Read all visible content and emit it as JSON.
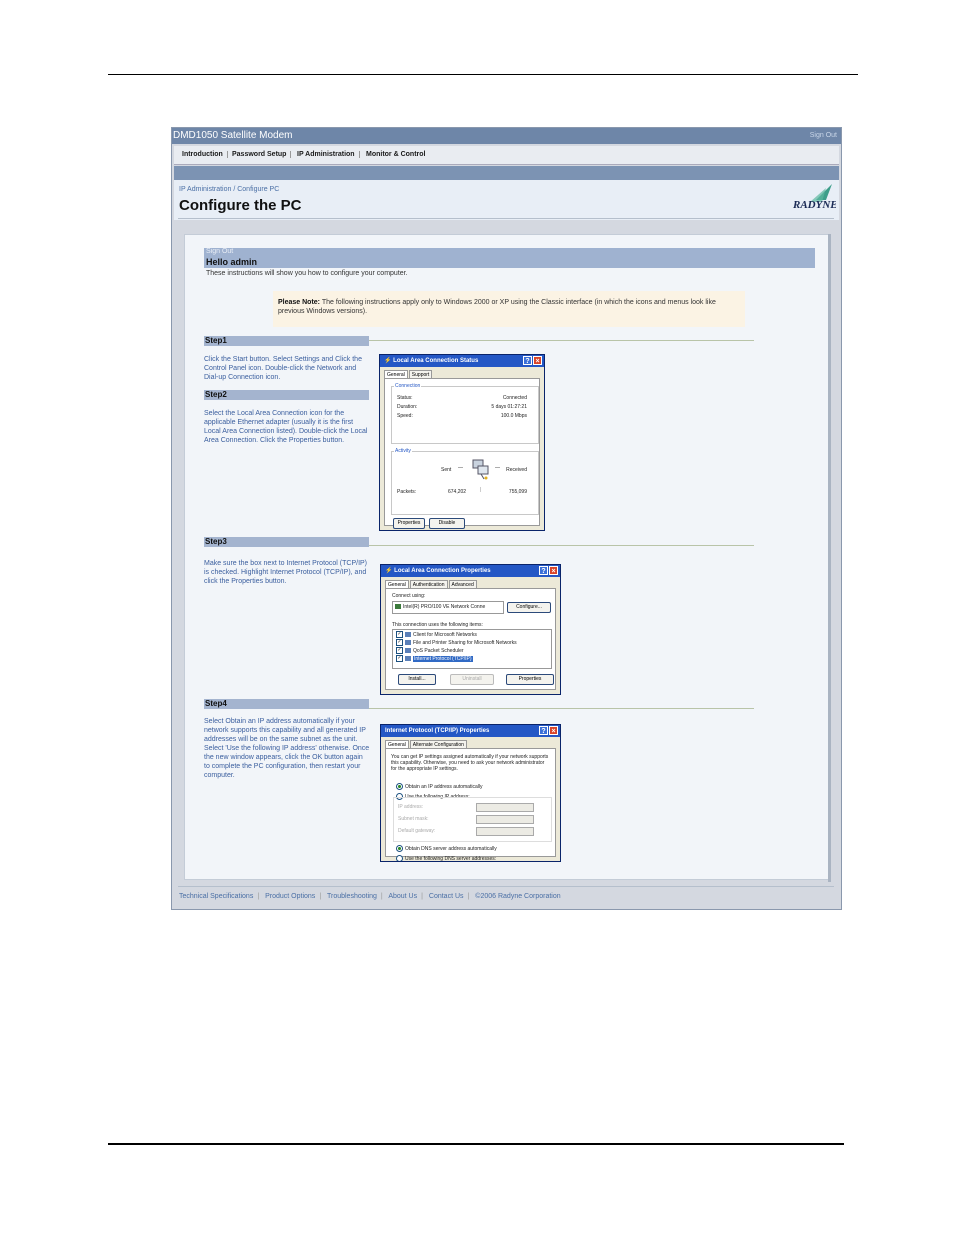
{
  "window": {
    "title": "DMD1050 Satellite Modem",
    "signout": "Sign Out"
  },
  "nav": {
    "items": [
      "Introduction",
      "Password Setup",
      "IP Administration",
      "Monitor & Control"
    ]
  },
  "header": {
    "breadcrumb": "IP Administration / Configure PC",
    "title": "Configure the PC",
    "logo_text": "RADYNE"
  },
  "greeting": {
    "signout": "Sign Out",
    "hello": "Hello admin",
    "intro": "These instructions will show you how to configure your computer."
  },
  "note": {
    "label": "Please Note:",
    "text": "The following instructions apply only to Windows 2000 or XP using the Classic interface (in which the icons and menus look like previous Windows versions)."
  },
  "steps": [
    {
      "label": "Step1",
      "text": "Click the Start button. Select Settings and Click the Control Panel icon. Double-click the Network and Dial-up Connection icon."
    },
    {
      "label": "Step2",
      "text": "Select the Local Area Connection icon for the applicable Ethernet adapter (usually it is the first Local Area Connection listed). Double-click the Local Area Connection. Click the Properties button."
    },
    {
      "label": "Step3",
      "text": "Make sure the box next to Internet Protocol (TCP/IP) is checked. Highlight Internet Protocol (TCP/IP), and click the Properties button."
    },
    {
      "label": "Step4",
      "text": "Select Obtain an IP address automatically if your network supports this capability and all generated IP addresses will be on the same subnet as the unit. Select 'Use the following IP address' otherwise. Once the new window appears, click the OK button again to complete the PC configuration, then restart your computer."
    }
  ],
  "dialog1": {
    "title": "Local Area Connection Status",
    "tabs": [
      "General",
      "Support"
    ],
    "connection_label": "Connection",
    "rows": [
      [
        "Status:",
        "Connected"
      ],
      [
        "Duration:",
        "5 days 01:27:21"
      ],
      [
        "Speed:",
        "100.0 Mbps"
      ]
    ],
    "activity_label": "Activity",
    "sent": "Sent",
    "received": "Received",
    "packets_label": "Packets:",
    "packets_sent": "674,202",
    "packets_received": "755,099",
    "buttons": [
      "Properties",
      "Disable"
    ]
  },
  "dialog2": {
    "title": "Local Area Connection Properties",
    "tabs": [
      "General",
      "Authentication",
      "Advanced"
    ],
    "connect_using": "Connect using:",
    "adapter": "Intel(R) PRO/100 VE Network Conne",
    "configure": "Configure...",
    "items_label": "This connection uses the following items:",
    "items": [
      "Client for Microsoft Networks",
      "File and Printer Sharing for Microsoft Networks",
      "QoS Packet Scheduler",
      "Internet Protocol (TCP/IP)"
    ],
    "buttons": [
      "Install...",
      "Uninstall",
      "Properties"
    ]
  },
  "dialog3": {
    "title": "Internet Protocol (TCP/IP) Properties",
    "tabs": [
      "General",
      "Alternate Configuration"
    ],
    "desc": "You can get IP settings assigned automatically if your network supports this capability. Otherwise, you need to ask your network administrator for the appropriate IP settings.",
    "opt_auto": "Obtain an IP address automatically",
    "opt_manual": "Use the following IP address:",
    "fields": [
      "IP address:",
      "Subnet mask:",
      "Default gateway:"
    ],
    "dns_auto": "Obtain DNS server address automatically",
    "dns_manual": "Use the following DNS server addresses:"
  },
  "footer": {
    "links": [
      "Technical Specifications",
      "Product Options",
      "Troubleshooting",
      "About Us",
      "Contact Us",
      "©2006 Radyne Corporation"
    ]
  }
}
